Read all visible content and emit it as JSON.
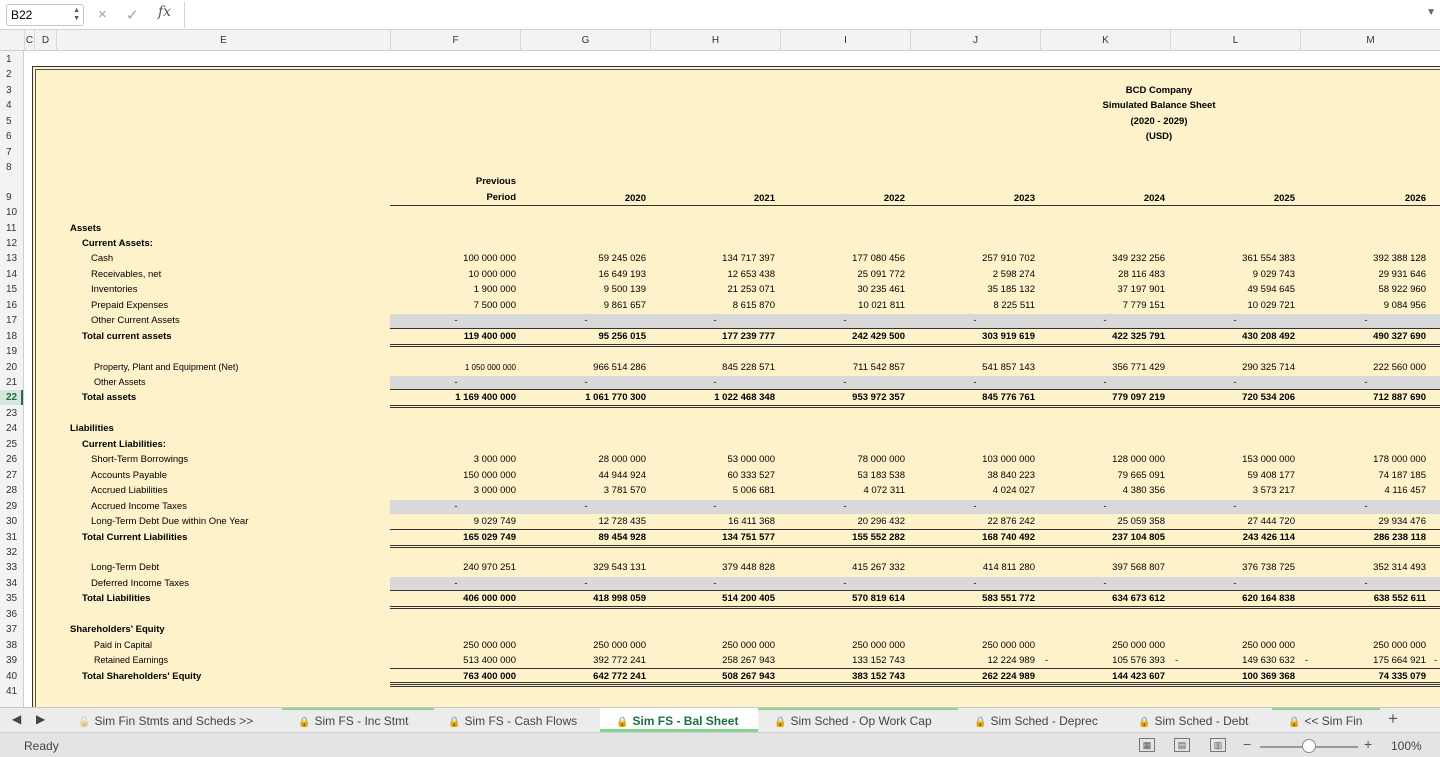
{
  "formula_bar": {
    "name_box": "B22",
    "cancel_icon": "×",
    "enter_icon": "✓",
    "fx_label": "fx",
    "formula": ""
  },
  "columns": [
    "C",
    "D",
    "E",
    "F",
    "G",
    "H",
    "I",
    "J",
    "K",
    "L",
    "M"
  ],
  "rows": [
    "1",
    "2",
    "3",
    "4",
    "5",
    "6",
    "7",
    "8",
    "9",
    "10",
    "11",
    "12",
    "13",
    "14",
    "15",
    "16",
    "17",
    "18",
    "19",
    "20",
    "21",
    "22",
    "23",
    "24",
    "25",
    "26",
    "27",
    "28",
    "29",
    "30",
    "31",
    "32",
    "33",
    "34",
    "35",
    "36",
    "37",
    "38",
    "39",
    "40",
    "41"
  ],
  "active_row": "22",
  "report": {
    "company": "BCD Company",
    "title": "Simulated Balance Sheet",
    "period": "(2020 - 2029)",
    "currency": "(USD)"
  },
  "period_header": {
    "line1": "Previous",
    "line2": "Period"
  },
  "years": [
    "2020",
    "2021",
    "2022",
    "2023",
    "2024",
    "2025",
    "2026"
  ],
  "sections": {
    "assets": "Assets",
    "current_assets": "Current Assets:",
    "liabilities": "Liabilities",
    "current_liabilities": "Current Liabilities:",
    "equity": "Shareholders' Equity"
  },
  "lines": [
    {
      "label": "Cash",
      "values": [
        "100 000 000",
        "59 245 026",
        "134 717 397",
        "177 080 456",
        "257 910 702",
        "349 232 256",
        "361 554 383",
        "392 388 128"
      ]
    },
    {
      "label": "Receivables, net",
      "values": [
        "10 000 000",
        "16 649 193",
        "12 653 438",
        "25 091 772",
        "2 598 274",
        "28 116 483",
        "9 029 743",
        "29 931 646"
      ]
    },
    {
      "label": "Inventories",
      "values": [
        "1 900 000",
        "9 500 139",
        "21 253 071",
        "30 235 461",
        "35 185 132",
        "37 197 901",
        "49 594 645",
        "58 922 960"
      ]
    },
    {
      "label": "Prepaid Expenses",
      "values": [
        "7 500 000",
        "9 861 657",
        "8 615 870",
        "10 021 811",
        "8 225 511",
        "7 779 151",
        "10 029 721",
        "9 084 956"
      ]
    },
    {
      "label": "Other Current Assets",
      "values": [
        "-",
        "-",
        "-",
        "-",
        "-",
        "-",
        "-",
        "-"
      ]
    },
    {
      "label": "Total current assets",
      "values": [
        "119 400 000",
        "95 256 015",
        "177 239 777",
        "242 429 500",
        "303 919 619",
        "422 325 791",
        "430 208 492",
        "490 327 690"
      ]
    },
    {
      "label": "Property, Plant and Equipment (Net)",
      "values": [
        "1 050 000 000",
        "966 514 286",
        "845 228 571",
        "711 542 857",
        "541 857 143",
        "356 771 429",
        "290 325 714",
        "222 560 000"
      ]
    },
    {
      "label": "Other Assets",
      "values": [
        "-",
        "-",
        "-",
        "-",
        "-",
        "-",
        "-",
        "-"
      ]
    },
    {
      "label": "Total assets",
      "values": [
        "1 169 400 000",
        "1 061 770 300",
        "1 022 468 348",
        "953 972 357",
        "845 776 761",
        "779 097 219",
        "720 534 206",
        "712 887 690"
      ]
    },
    {
      "label": "Short-Term Borrowings",
      "values": [
        "3 000 000",
        "28 000 000",
        "53 000 000",
        "78 000 000",
        "103 000 000",
        "128 000 000",
        "153 000 000",
        "178 000 000"
      ]
    },
    {
      "label": "Accounts Payable",
      "values": [
        "150 000 000",
        "44 944 924",
        "60 333 527",
        "53 183 538",
        "38 840 223",
        "79 665 091",
        "59 408 177",
        "74 187 185"
      ]
    },
    {
      "label": "Accrued Liabilities",
      "values": [
        "3 000 000",
        "3 781 570",
        "5 006 681",
        "4 072 311",
        "4 024 027",
        "4 380 356",
        "3 573 217",
        "4 116 457"
      ]
    },
    {
      "label": "Accrued Income Taxes",
      "values": [
        "-",
        "-",
        "-",
        "-",
        "-",
        "-",
        "-",
        "-"
      ]
    },
    {
      "label": "Long-Term Debt Due within One Year",
      "values": [
        "9 029 749",
        "12 728 435",
        "16 411 368",
        "20 296 432",
        "22 876 242",
        "25 059 358",
        "27 444 720",
        "29 934 476"
      ]
    },
    {
      "label": "Total Current Liabilities",
      "values": [
        "165 029 749",
        "89 454 928",
        "134 751 577",
        "155 552 282",
        "168 740 492",
        "237 104 805",
        "243 426 114",
        "286 238 118"
      ]
    },
    {
      "label": "Long-Term Debt",
      "values": [
        "240 970 251",
        "329 543 131",
        "379 448 828",
        "415 267 332",
        "414 811 280",
        "397 568 807",
        "376 738 725",
        "352 314 493"
      ]
    },
    {
      "label": "Deferred Income Taxes",
      "values": [
        "-",
        "-",
        "-",
        "-",
        "-",
        "-",
        "-",
        "-"
      ]
    },
    {
      "label": "Total Liabilities",
      "values": [
        "406 000 000",
        "418 998 059",
        "514 200 405",
        "570 819 614",
        "583 551 772",
        "634 673 612",
        "620 164 838",
        "638 552 611"
      ]
    },
    {
      "label": "Paid in Capital",
      "values": [
        "250 000 000",
        "250 000 000",
        "250 000 000",
        "250 000 000",
        "250 000 000",
        "250 000 000",
        "250 000 000",
        "250 000 000"
      ]
    },
    {
      "label": "Retained Earnings",
      "values": [
        "513 400 000",
        "392 772 241",
        "258 267 943",
        "133 152 743",
        "12 224 989",
        "105 576 393",
        "149 630 632",
        "175 664 921"
      ]
    },
    {
      "label": "Total Shareholders' Equity",
      "values": [
        "763 400 000",
        "642 772 241",
        "508 267 943",
        "383 152 743",
        "262 224 989",
        "144 423 607",
        "100 369 368",
        "74 335 079"
      ]
    }
  ],
  "tabs": [
    {
      "label": "Sim Fin Stmts and Scheds >>",
      "locked": false
    },
    {
      "label": "Sim FS - Inc Stmt",
      "locked": true
    },
    {
      "label": "Sim FS - Cash Flows",
      "locked": true
    },
    {
      "label": "Sim FS - Bal Sheet",
      "locked": true
    },
    {
      "label": "Sim Sched - Op Work Cap",
      "locked": true
    },
    {
      "label": "Sim Sched - Deprec",
      "locked": true
    },
    {
      "label": "Sim Sched - Debt",
      "locked": true
    },
    {
      "label": "<< Sim Fin",
      "locked": true
    }
  ],
  "status": {
    "text": "Ready",
    "zoom": "100%",
    "zoom_value": 100
  }
}
